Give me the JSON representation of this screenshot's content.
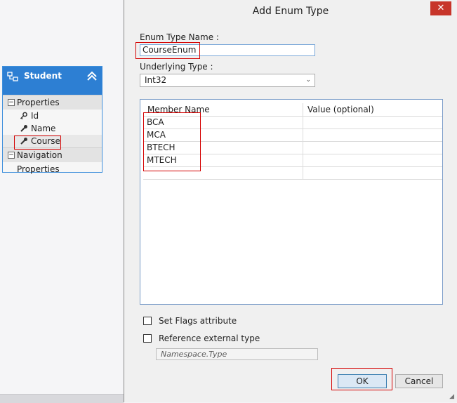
{
  "entity": {
    "name": "Student",
    "sections": {
      "properties": "Properties",
      "navigation": "Navigation Properties"
    },
    "properties": [
      "Id",
      "Name",
      "Course"
    ],
    "collapse_symbol": "⊟"
  },
  "dialog": {
    "title": "Add Enum Type",
    "close_symbol": "✕",
    "enum_name_label": "Enum Type Name :",
    "enum_name_value": "CourseEnum",
    "underlying_label": "Underlying Type :",
    "underlying_value": "Int32",
    "grid": {
      "columns": [
        "Member Name",
        "Value (optional)"
      ],
      "rows": [
        "BCA",
        "MCA",
        "BTECH",
        "MTECH",
        ""
      ]
    },
    "flags_label": "Set Flags attribute",
    "reference_label": "Reference external type",
    "namespace_placeholder": "Namespace.Type",
    "ok_label": "OK",
    "cancel_label": "Cancel"
  },
  "colors": {
    "entity_header": "#2d7fd3",
    "highlight": "#d40000",
    "close_button": "#c7352a"
  }
}
